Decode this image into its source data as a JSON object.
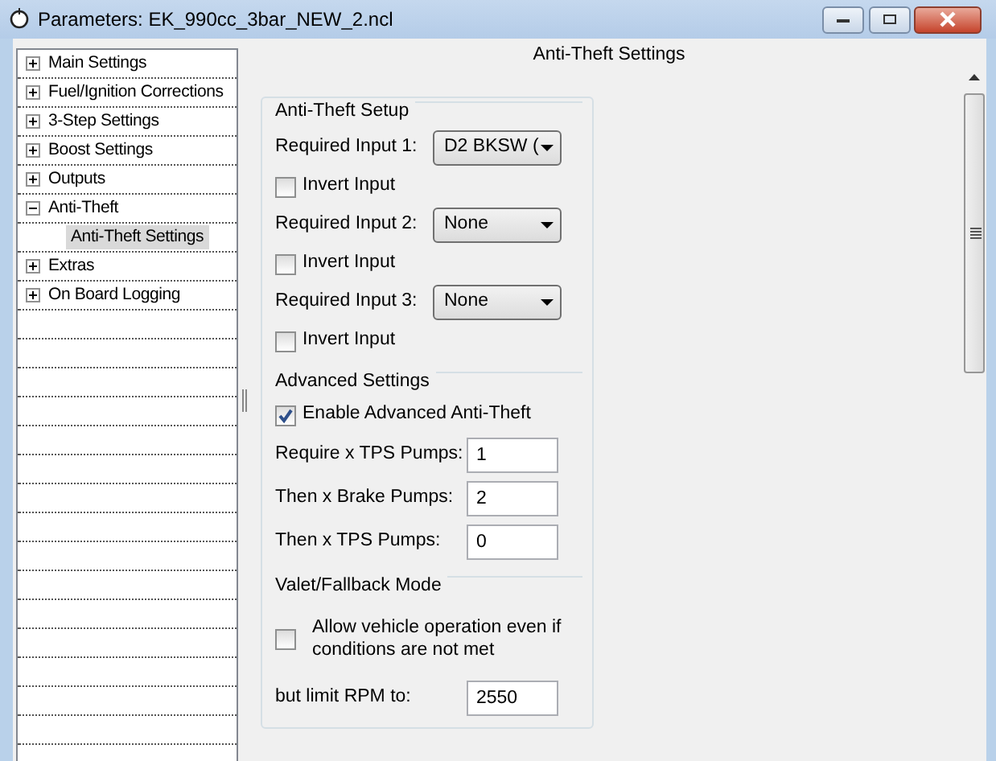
{
  "window": {
    "title": "Parameters: EK_990cc_3bar_NEW_2.ncl"
  },
  "tree": {
    "items": [
      {
        "label": "Main Settings",
        "expanded": false
      },
      {
        "label": "Fuel/Ignition Corrections",
        "expanded": false
      },
      {
        "label": "3-Step Settings",
        "expanded": false
      },
      {
        "label": "Boost Settings",
        "expanded": false
      },
      {
        "label": "Outputs",
        "expanded": false
      },
      {
        "label": "Anti-Theft",
        "expanded": true,
        "children": [
          {
            "label": "Anti-Theft Settings",
            "selected": true
          }
        ]
      },
      {
        "label": "Extras",
        "expanded": false
      },
      {
        "label": "On Board Logging",
        "expanded": false
      }
    ]
  },
  "heading": "Anti-Theft Settings",
  "groups": [
    {
      "title": "Anti-Theft Setup",
      "rows": [
        {
          "kind": "select",
          "label": "Required Input 1:",
          "value": "D2 BKSW ("
        },
        {
          "kind": "checkbox",
          "label": "Invert Input",
          "checked": false
        },
        {
          "kind": "select",
          "label": "Required Input 2:",
          "value": "None"
        },
        {
          "kind": "checkbox",
          "label": "Invert Input",
          "checked": false
        },
        {
          "kind": "select",
          "label": "Required Input 3:",
          "value": "None"
        },
        {
          "kind": "checkbox",
          "label": "Invert Input",
          "checked": false
        }
      ]
    },
    {
      "title": "Advanced Settings",
      "rows": [
        {
          "kind": "checkbox",
          "label": "Enable Advanced Anti-Theft",
          "checked": true
        },
        {
          "kind": "number",
          "label": "Require x TPS Pumps:",
          "value": "1"
        },
        {
          "kind": "number",
          "label": "Then x Brake Pumps:",
          "value": "2"
        },
        {
          "kind": "number",
          "label": "Then x TPS Pumps:",
          "value": "0"
        }
      ]
    },
    {
      "title": "Valet/Fallback Mode",
      "rows": [
        {
          "kind": "checkbox",
          "label": "Allow vehicle operation even if conditions are not met",
          "checked": false
        },
        {
          "kind": "number",
          "label": "but limit RPM to:",
          "value": "2550"
        }
      ]
    }
  ]
}
